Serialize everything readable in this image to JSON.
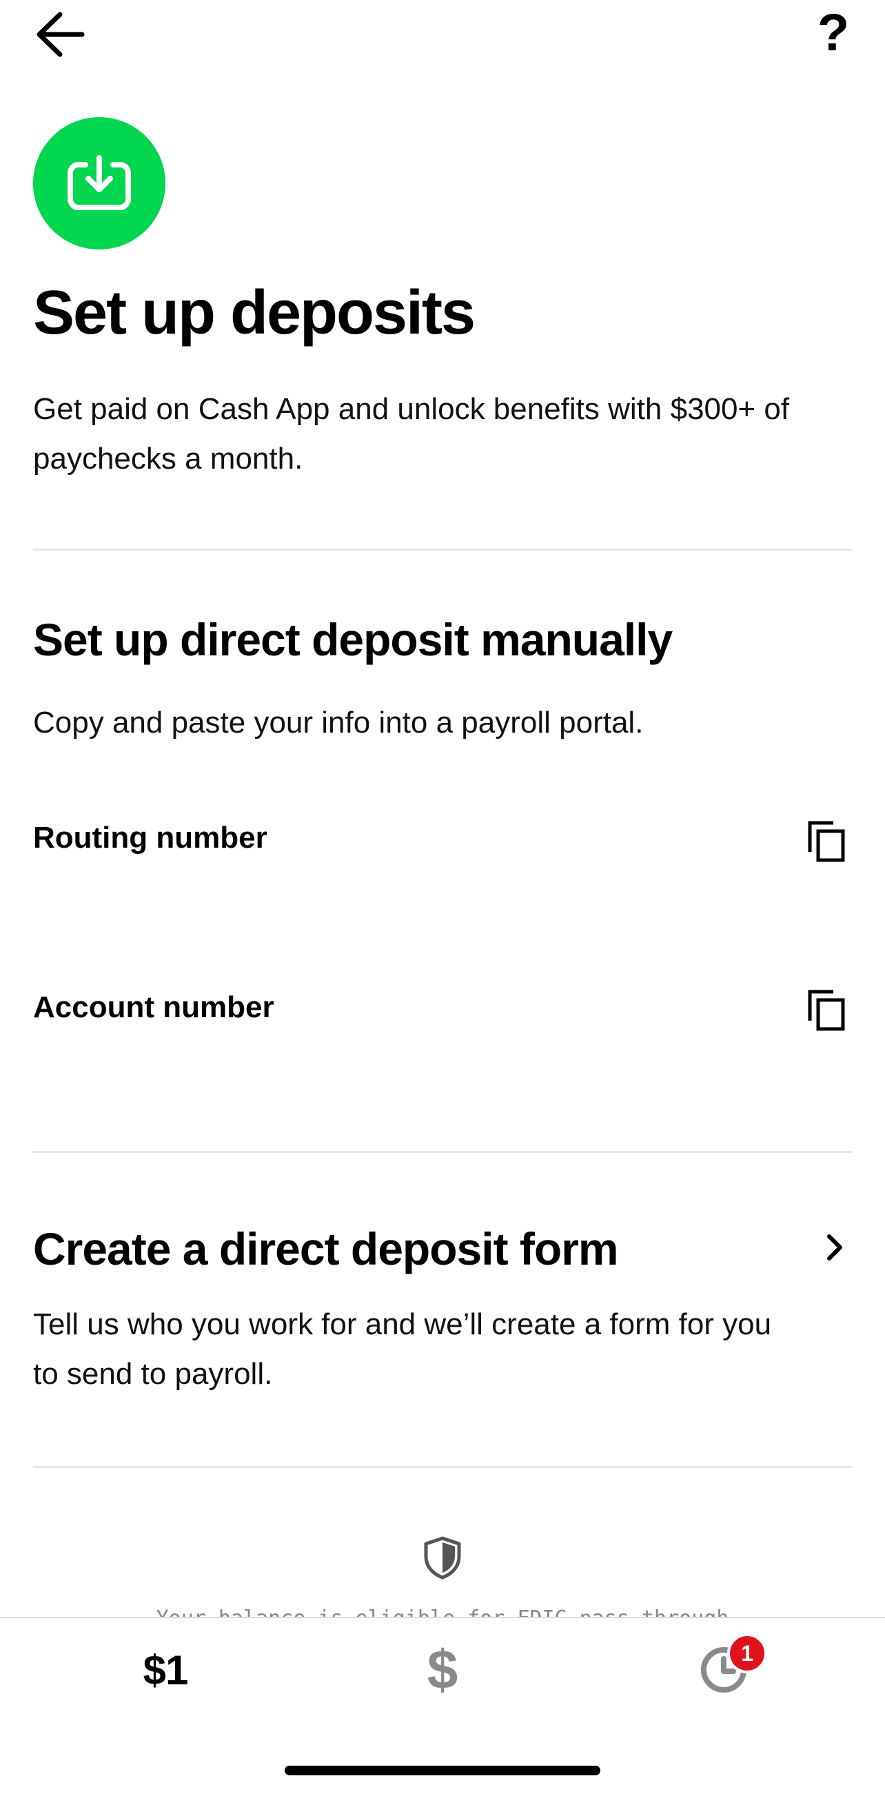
{
  "header": {
    "back_icon": "arrow-left-icon",
    "help_label": "?"
  },
  "hero": {
    "icon": "download-icon",
    "icon_color": "#00d64f",
    "title": "Set up deposits",
    "subtitle": "Get paid on Cash App and unlock benefits with $300+ of paychecks a month."
  },
  "manual": {
    "title": "Set up direct deposit manually",
    "description": "Copy and paste your info into a payroll portal.",
    "routing_label": "Routing number",
    "account_label": "Account number",
    "copy_icon": "copy-icon"
  },
  "form": {
    "title": "Create a direct deposit form",
    "description": "Tell us who you work for and we’ll create a form for you to send to payroll.",
    "chevron_icon": "chevron-right-icon"
  },
  "footer": {
    "shield_icon": "shield-icon",
    "fdic_text": "Your balance is eligible for FDIC pass-through"
  },
  "tabbar": {
    "balance_label": "$1",
    "pay_label": "$",
    "activity_icon": "clock-icon",
    "activity_badge": "1",
    "badge_color": "#e0121b"
  }
}
